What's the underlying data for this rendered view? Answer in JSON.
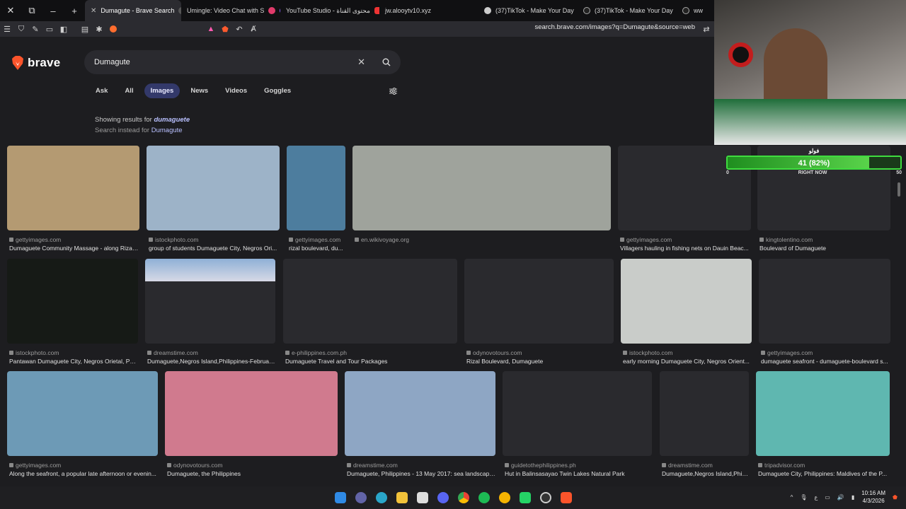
{
  "tabs": [
    {
      "label": "Dumagute - Brave Search",
      "active": true
    },
    {
      "label": "Umingle: Video Chat with S",
      "active": false
    },
    {
      "label": "YouTube Studio - محتوى القناة",
      "active": false
    },
    {
      "label": "jw.alooytv10.xyz",
      "active": false
    },
    {
      "label": "(37)TikTok - Make Your Day",
      "active": false
    },
    {
      "label": "(37)TikTok - Make Your Day",
      "active": false
    },
    {
      "label": "ww",
      "active": false
    }
  ],
  "url": "search.brave.com/images?q=Dumagute&source=web",
  "brand": "brave",
  "search": {
    "query": "Dumagute"
  },
  "nav": [
    "Ask",
    "All",
    "Images",
    "News",
    "Videos",
    "Goggles"
  ],
  "nav_active": "Images",
  "showing": {
    "prefix": "Showing results for ",
    "corrected": "dumaguete",
    "alt_prefix": "Search instead for ",
    "alt": "Dumagute"
  },
  "results": [
    {
      "source": "gettyimages.com",
      "title": "Dumaguete Community Massage - along Rizal ...",
      "color": "#b49a72"
    },
    {
      "source": "istockphoto.com",
      "title": "group of students Dumaguete City, Negros Ori...",
      "color": "#9db3c8"
    },
    {
      "source": "gettyimages.com",
      "title": "rizal boulevard, du...",
      "color": "#4d7d9e"
    },
    {
      "source": "en.wikivoyage.org",
      "title": "",
      "color": "#9fa39c"
    },
    {
      "source": "gettyimages.com",
      "title": "Villagers hauling in fishing nets on Dauin Beac...",
      "color": "#2a2a2e"
    },
    {
      "source": "kingtolentino.com",
      "title": "Boulevard of Dumaguete",
      "color": "#2a2a2e"
    },
    {
      "source": "istockphoto.com",
      "title": "Pantawan Dumaguete City, Negros Orietal, Ph...",
      "color": "#161a16"
    },
    {
      "source": "dreamstime.com",
      "title": "Dumaguete,Negros Island,Philippines-Februar...",
      "color": "#2a2a2e"
    },
    {
      "source": "e-philippines.com.ph",
      "title": "Dumaguete Travel and Tour Packages",
      "color": "#2a2a2e"
    },
    {
      "source": "odynovotours.com",
      "title": "Rizal Boulevard, Dumaguete",
      "color": "#2a2a2e"
    },
    {
      "source": "istockphoto.com",
      "title": "early morning Dumaguete City, Negros Orient...",
      "color": "#c9ccc9"
    },
    {
      "source": "gettyimages.com",
      "title": "dumaguete seafront - dumaguete-boulevard s...",
      "color": "#2a2a2e"
    },
    {
      "source": "gettyimages.com",
      "title": "Along the seafront, a popular late afternoon or evenin...",
      "color": "#6d9ab6"
    },
    {
      "source": "odynovotours.com",
      "title": "Dumaguete, the Philippines",
      "color": "#d07a8e"
    },
    {
      "source": "dreamstime.com",
      "title": "Dumaguete, Philippines - 13 May 2017: sea landscape...",
      "color": "#8ea6c4"
    },
    {
      "source": "guidetothephilippines.ph",
      "title": "Hut in Balinsasayao Twin Lakes Natural Park",
      "color": "#2a2a2e"
    },
    {
      "source": "dreamstime.com",
      "title": "Dumaguete,Negros Island,Phili...",
      "color": "#2a2a2e"
    },
    {
      "source": "tripadvisor.com",
      "title": "Dumaguete City, Philippines: Maldives of the P...",
      "color": "#5fb7b0"
    }
  ],
  "overlay": {
    "title": "فولو",
    "value": "41 (82%)",
    "progress": 0.82,
    "min": "0",
    "label": "RIGHT NOW",
    "max": "50"
  },
  "clock": {
    "time": "10:16 AM",
    "date": "4/3/2026",
    "lang": "ع"
  }
}
